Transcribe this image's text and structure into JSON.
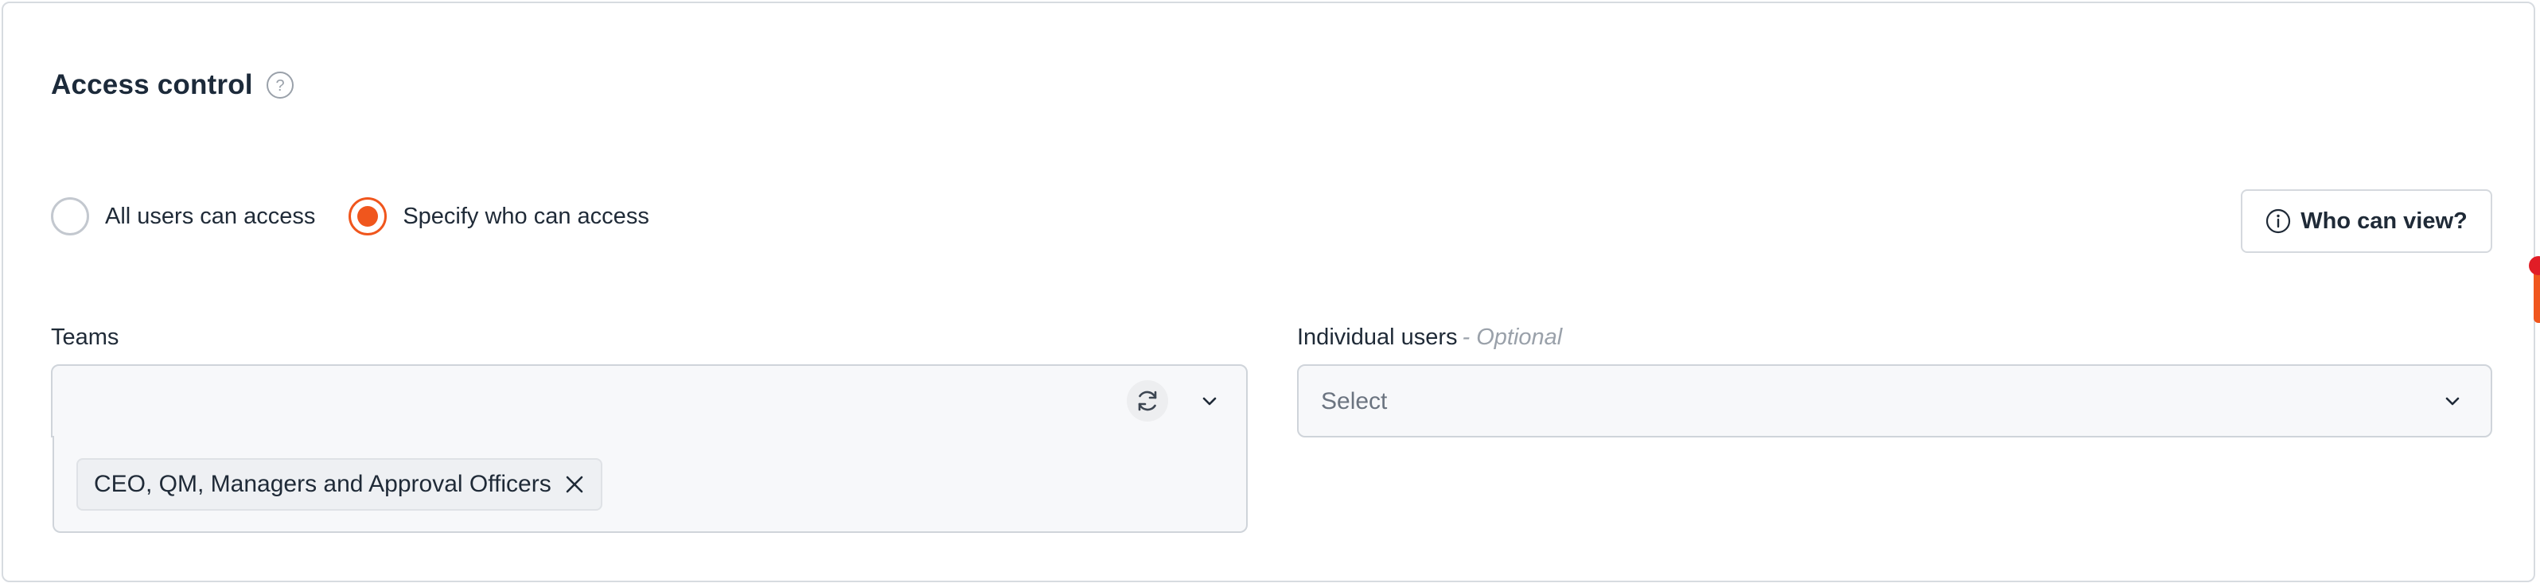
{
  "section": {
    "title": "Access control",
    "help_icon": "question-circle-icon"
  },
  "access_mode": {
    "options": [
      {
        "label": "All users can access",
        "selected": false
      },
      {
        "label": "Specify who can access",
        "selected": true
      }
    ]
  },
  "who_can_view_button": {
    "label": "Who can view?",
    "icon": "info-circle-icon"
  },
  "teams": {
    "label": "Teams",
    "selected_tags": [
      "CEO, QM, Managers and Approval Officers"
    ],
    "refresh_icon": "refresh-icon",
    "dropdown_icon": "chevron-down-icon",
    "remove_icon": "close-icon"
  },
  "individual_users": {
    "label": "Individual users",
    "optional_hint": "- Optional",
    "placeholder": "Select",
    "dropdown_icon": "chevron-down-icon"
  },
  "colors": {
    "accent": "#f0561d",
    "notification_dot": "#e11d26",
    "border": "#cfd4da",
    "field_bg": "#f7f8fa"
  }
}
